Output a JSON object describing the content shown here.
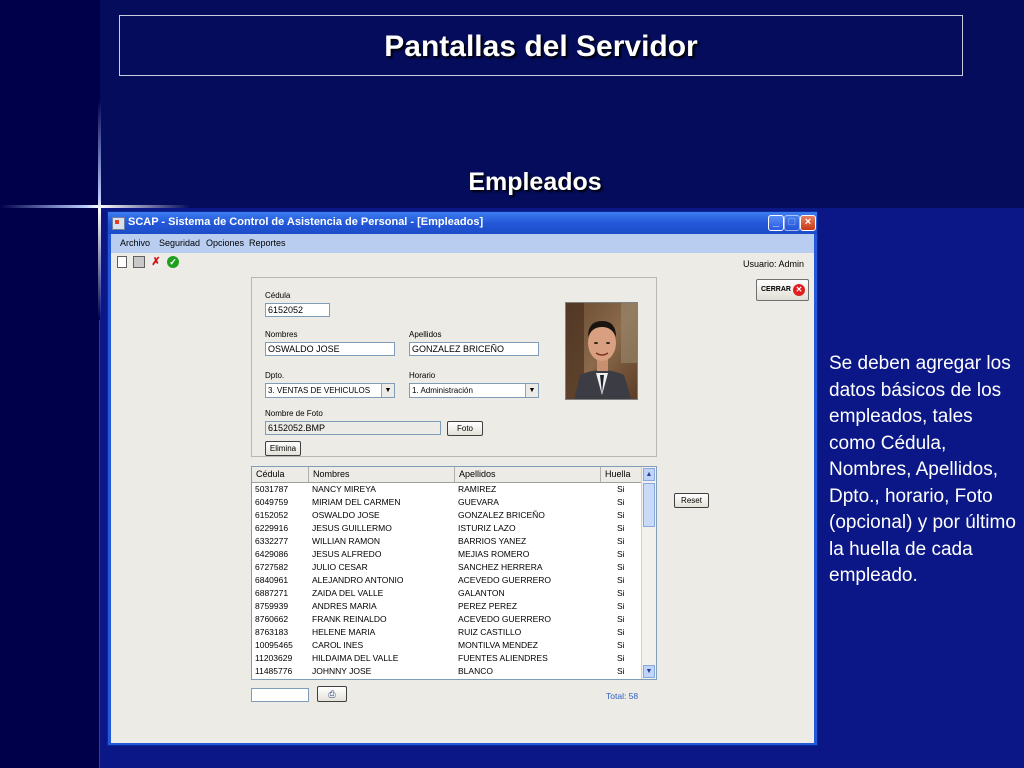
{
  "slide": {
    "title": "Pantallas del Servidor",
    "subtitle": "Empleados",
    "description": "Se deben agregar los datos básicos de los empleados, tales como Cédula, Nombres, Apellidos, Dpto., horario, Foto (opcional) y por último la huella de cada empleado."
  },
  "window": {
    "title": "SCAP - Sistema de Control de Asistencia de Personal - [Empleados]",
    "menu": [
      "Archivo",
      "Seguridad",
      "Opciones",
      "Reportes"
    ],
    "toolbar_icons": [
      "new-icon",
      "save-icon",
      "delete-icon",
      "check-icon"
    ],
    "usuario": "Usuario: Admin",
    "close_button_label": "CERRAR"
  },
  "form": {
    "cedula_label": "Cédula",
    "cedula_value": "6152052",
    "nombres_label": "Nombres",
    "nombres_value": "OSWALDO JOSE",
    "apellidos_label": "Apellidos",
    "apellidos_value": "GONZALEZ BRICEÑO",
    "dpto_label": "Dpto.",
    "dpto_value": "3.  VENTAS DE VEHICULOS",
    "horario_label": "Horario",
    "horario_value": "1.  Administración",
    "foto_label": "Nombre de Foto",
    "foto_value": "6152052.BMP",
    "foto_button": "Foto",
    "elimina_button": "Elimina"
  },
  "grid": {
    "columns": [
      "Cédula",
      "Nombres",
      "Apellidos",
      "Huella"
    ],
    "rows": [
      [
        "5031787",
        "NANCY MIREYA",
        "RAMIREZ",
        "Si"
      ],
      [
        "6049759",
        "MIRIAM DEL CARMEN",
        "GUEVARA",
        "Si"
      ],
      [
        "6152052",
        "OSWALDO JOSE",
        "GONZALEZ BRICEÑO",
        "Si"
      ],
      [
        "6229916",
        "JESUS GUILLERMO",
        "ISTURIZ LAZO",
        "Si"
      ],
      [
        "6332277",
        "WILLIAN RAMON",
        "BARRIOS YANEZ",
        "Si"
      ],
      [
        "6429086",
        "JESUS ALFREDO",
        "MEJIAS ROMERO",
        "Si"
      ],
      [
        "6727582",
        "JULIO CESAR",
        "SANCHEZ HERRERA",
        "Si"
      ],
      [
        "6840961",
        "ALEJANDRO ANTONIO",
        "ACEVEDO GUERRERO",
        "Si"
      ],
      [
        "6887271",
        "ZAIDA DEL VALLE",
        "GALANTON",
        "Si"
      ],
      [
        "8759939",
        "ANDRES MARIA",
        "PEREZ PEREZ",
        "Si"
      ],
      [
        "8760662",
        "FRANK REINALDO",
        "ACEVEDO GUERRERO",
        "Si"
      ],
      [
        "8763183",
        "HELENE MARIA",
        "RUIZ CASTILLO",
        "Si"
      ],
      [
        "10095465",
        "CAROL INES",
        "MONTILVA MENDEZ",
        "Si"
      ],
      [
        "11203629",
        "HILDAIMA DEL VALLE",
        "FUENTES ALIENDRES",
        "Si"
      ],
      [
        "11485776",
        "JOHNNY JOSE",
        "BLANCO",
        "Si"
      ]
    ],
    "reset_button": "Reset",
    "search_value": "",
    "total": "Total: 58"
  }
}
